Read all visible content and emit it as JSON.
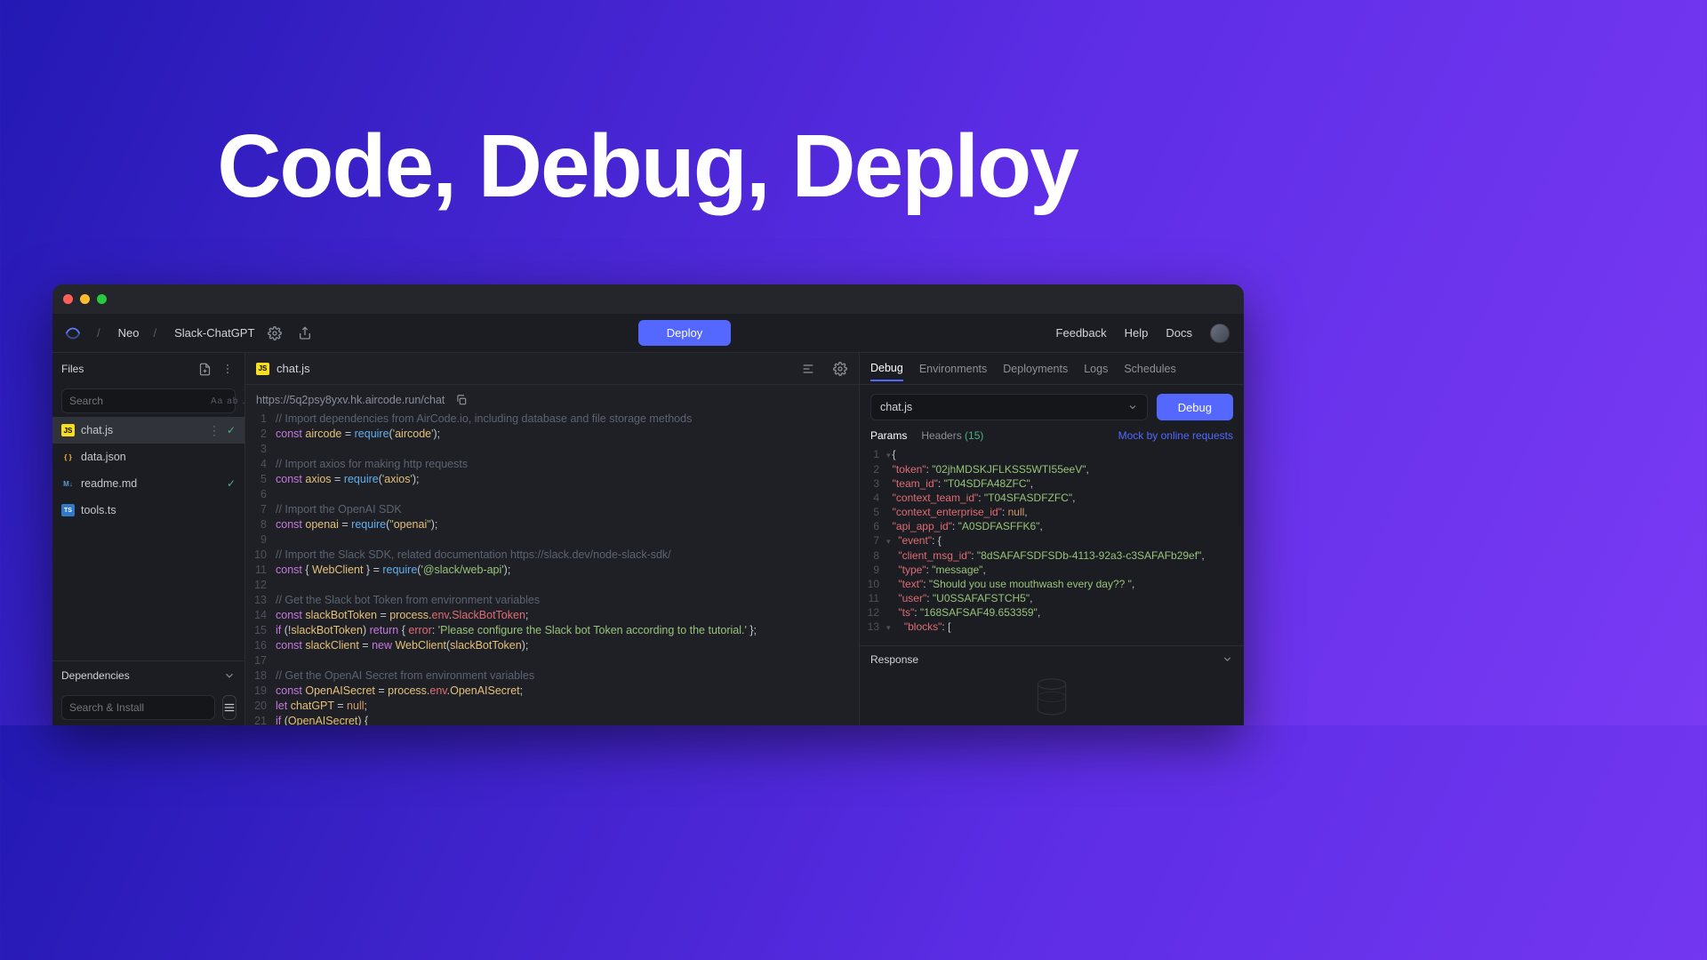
{
  "hero": {
    "title": "Code, Debug, Deploy"
  },
  "breadcrumb": {
    "user": "Neo",
    "project": "Slack-ChatGPT"
  },
  "deploy_button": "Deploy",
  "top_links": {
    "feedback": "Feedback",
    "help": "Help",
    "docs": "Docs"
  },
  "sidebar": {
    "files_label": "Files",
    "search_placeholder": "Search",
    "files": [
      {
        "name": "chat.js",
        "icon": "js",
        "active": true,
        "checked": true
      },
      {
        "name": "data.json",
        "icon": "json",
        "active": false,
        "checked": false
      },
      {
        "name": "readme.md",
        "icon": "md",
        "active": false,
        "checked": true
      },
      {
        "name": "tools.ts",
        "icon": "ts",
        "active": false,
        "checked": false
      }
    ],
    "deps_label": "Dependencies",
    "deps_placeholder": "Search & Install"
  },
  "editor": {
    "filename": "chat.js",
    "url": "https://5q2psy8yxv.hk.aircode.run/chat",
    "code": [
      {
        "n": 1,
        "t": "comment",
        "s": "// Import dependencies from AirCode.io, including database and file storage methods"
      },
      {
        "n": 2,
        "t": "code",
        "s": "const aircode = require('aircode');"
      },
      {
        "n": 3,
        "t": "blank",
        "s": ""
      },
      {
        "n": 4,
        "t": "comment",
        "s": "// Import axios for making http requests"
      },
      {
        "n": 5,
        "t": "code",
        "s": "const axios = require('axios');"
      },
      {
        "n": 6,
        "t": "blank",
        "s": ""
      },
      {
        "n": 7,
        "t": "comment",
        "s": "// Import the OpenAI SDK"
      },
      {
        "n": 8,
        "t": "code",
        "s": "const openai = require(\"openai\");"
      },
      {
        "n": 9,
        "t": "blank",
        "s": ""
      },
      {
        "n": 10,
        "t": "comment",
        "s": "// Import the Slack SDK, related documentation https://slack.dev/node-slack-sdk/"
      },
      {
        "n": 11,
        "t": "code",
        "s": "const { WebClient } = require('@slack/web-api');"
      },
      {
        "n": 12,
        "t": "blank",
        "s": ""
      },
      {
        "n": 13,
        "t": "comment",
        "s": "// Get the Slack bot Token from environment variables"
      },
      {
        "n": 14,
        "t": "code",
        "s": "const slackBotToken = process.env.SlackBotToken;"
      },
      {
        "n": 15,
        "t": "code",
        "s": "if (!slackBotToken) return { error: 'Please configure the Slack bot Token according to the tutorial.' };"
      },
      {
        "n": 16,
        "t": "code",
        "s": "const slackClient = new WebClient(slackBotToken);"
      },
      {
        "n": 17,
        "t": "blank",
        "s": ""
      },
      {
        "n": 18,
        "t": "comment",
        "s": "// Get the OpenAI Secret from environment variables"
      },
      {
        "n": 19,
        "t": "code",
        "s": "const OpenAISecret = process.env.OpenAISecret;"
      },
      {
        "n": 20,
        "t": "code",
        "s": "let chatGPT = null;"
      },
      {
        "n": 21,
        "t": "code",
        "s": "if (OpenAISecret) {"
      }
    ]
  },
  "debug": {
    "tabs": [
      "Debug",
      "Environments",
      "Deployments",
      "Logs",
      "Schedules"
    ],
    "active_tab": "Debug",
    "select_value": "chat.js",
    "debug_button": "Debug",
    "subtab_params": "Params",
    "subtab_headers": "Headers",
    "subtab_headers_count": "(15)",
    "mock_link": "Mock by online requests",
    "payload": [
      {
        "n": 1,
        "fold": true,
        "s": "{"
      },
      {
        "n": 2,
        "s": "  \"token\": \"02jhMDSKJFLKSS5WTI55eeV\","
      },
      {
        "n": 3,
        "s": "  \"team_id\": \"T04SDFA48ZFC\","
      },
      {
        "n": 4,
        "s": "  \"context_team_id\": \"T04SFASDFZFC\","
      },
      {
        "n": 5,
        "s": "  \"context_enterprise_id\": null,"
      },
      {
        "n": 6,
        "s": "  \"api_app_id\": \"A0SDFASFFK6\","
      },
      {
        "n": 7,
        "fold": true,
        "s": "  \"event\": {"
      },
      {
        "n": 8,
        "s": "    \"client_msg_id\": \"8dSAFAFSDFSDb-4113-92a3-c3SAFAFb29ef\","
      },
      {
        "n": 9,
        "s": "    \"type\": \"message\","
      },
      {
        "n": 10,
        "s": "    \"text\": \"Should you use mouthwash every day?? \","
      },
      {
        "n": 11,
        "s": "    \"user\": \"U0SSAFAFSTCH5\","
      },
      {
        "n": 12,
        "s": "    \"ts\": \"168SAFSAF49.653359\","
      },
      {
        "n": 13,
        "fold": true,
        "s": "    \"blocks\": ["
      }
    ],
    "response_label": "Response"
  }
}
